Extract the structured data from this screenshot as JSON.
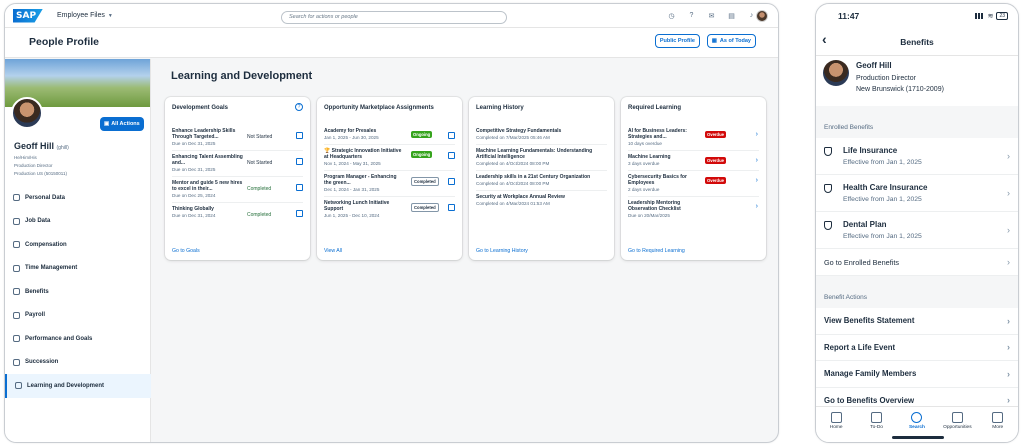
{
  "desktop": {
    "shell": {
      "logo": "SAP",
      "app_menu": "Employee Files",
      "search_placeholder": "Search for actions or people",
      "icons": [
        "clock-icon",
        "help-icon",
        "chat-icon",
        "notes-icon",
        "bell-icon"
      ]
    },
    "header": {
      "title": "People Profile",
      "public_profile": "Public Profile",
      "as_of_today": "As of Today"
    },
    "employee": {
      "name": "Geoff Hill",
      "uid": "(ghill)",
      "pronouns": "He/Him/His",
      "role": "Production Director",
      "location": "Production US (50150011)",
      "all_actions": "All Actions"
    },
    "nav": [
      {
        "label": "Personal Data",
        "icon": "person-icon"
      },
      {
        "label": "Job Data",
        "icon": "briefcase-icon"
      },
      {
        "label": "Compensation",
        "icon": "money-icon"
      },
      {
        "label": "Time Management",
        "icon": "clock-icon"
      },
      {
        "label": "Benefits",
        "icon": "shield-icon"
      },
      {
        "label": "Payroll",
        "icon": "payroll-icon"
      },
      {
        "label": "Performance and Goals",
        "icon": "target-icon"
      },
      {
        "label": "Succession",
        "icon": "org-icon"
      },
      {
        "label": "Learning and Development",
        "icon": "learning-icon",
        "active": true
      }
    ],
    "section_title": "Learning and Development",
    "cards": {
      "goals": {
        "title": "Development Goals",
        "items": [
          {
            "title": "Enhance Leadership Skills Through Targeted...",
            "due": "Due on Dec 31, 2025",
            "status": "Not Started"
          },
          {
            "title": "Enhancing Talent Assembling and...",
            "due": "Due on Dec 31, 2025",
            "status": "Not Started"
          },
          {
            "title": "Mentor and guide 5 new hires to excel in their...",
            "due": "Due on Dec 25, 2024",
            "status": "Completed"
          },
          {
            "title": "Thinking Globally",
            "due": "Due on Dec 31, 2024",
            "status": "Completed"
          }
        ],
        "link": "Go to Goals"
      },
      "marketplace": {
        "title": "Opportunity Marketplace Assignments",
        "items": [
          {
            "title": "Academy for Presales",
            "dates": "Jan 1, 2025 - Jun 30, 2025",
            "status": "Ongoing"
          },
          {
            "title": "🏆 Strategic Innovation Initiative at Headquarters",
            "dates": "Nov 1, 2024 - May 31, 2025",
            "status": "Ongoing"
          },
          {
            "title": "Program Manager - Enhancing the green...",
            "dates": "Dec 1, 2024 - Jan 31, 2025",
            "status": "Completed"
          },
          {
            "title": "Networking Lunch Initiative Support",
            "dates": "Jun 1, 2025 - Dec 10, 2024",
            "status": "Completed"
          }
        ],
        "link": "View All"
      },
      "history": {
        "title": "Learning History",
        "items": [
          {
            "title": "Competitive Strategy Fundamentals",
            "date": "Completed on 7/Mar/2025 05:46 AM"
          },
          {
            "title": "Machine Learning Fundamentals: Understanding Artificial Intelligence",
            "date": "Completed on 4/Oct/2024 08:00 PM"
          },
          {
            "title": "Leadership skills in a 21st Century Organization",
            "date": "Completed on 4/Oct/2024 08:00 PM"
          },
          {
            "title": "Security at Workplace Annual Review",
            "date": "Completed on 4/Mar/2024 01:53 AM"
          }
        ],
        "link": "Go to Learning History"
      },
      "required": {
        "title": "Required Learning",
        "items": [
          {
            "title": "AI for Business Leaders: Strategies and...",
            "due": "10 days overdue",
            "status": "Overdue"
          },
          {
            "title": "Machine Learning",
            "due": "3 days overdue",
            "status": "Overdue"
          },
          {
            "title": "Cybersecurity Basics for Employees",
            "due": "2 days overdue",
            "status": "Overdue"
          },
          {
            "title": "Leadership Mentoring Observation Checklist",
            "due": "Due on 20/Mar/2025",
            "status": ""
          }
        ],
        "link": "Go to Required Learning"
      }
    }
  },
  "mobile": {
    "time": "11:47",
    "battery": "23",
    "title": "Benefits",
    "profile": {
      "name": "Geoff Hill",
      "role": "Production Director",
      "location": "New Brunswick (1710-2009)"
    },
    "enrolled_header": "Enrolled Benefits",
    "benefits": [
      {
        "name": "Life Insurance",
        "effective": "Effective from Jan 1, 2025"
      },
      {
        "name": "Health Care Insurance",
        "effective": "Effective from Jan 1, 2025"
      },
      {
        "name": "Dental Plan",
        "effective": "Effective from Jan 1, 2025"
      }
    ],
    "enrolled_link": "Go to Enrolled Benefits",
    "actions_header": "Benefit Actions",
    "actions": [
      "View Benefits Statement",
      "Report a Life Event",
      "Manage Family Members",
      "Go to Benefits Overview"
    ],
    "tabs": [
      {
        "label": "Home",
        "icon": "home-icon"
      },
      {
        "label": "To-Do",
        "icon": "clipboard-icon"
      },
      {
        "label": "Search",
        "icon": "search-icon",
        "active": true
      },
      {
        "label": "Opportunities",
        "icon": "sparkle-icon"
      },
      {
        "label": "More",
        "icon": "menu-icon"
      }
    ],
    "colors": {
      "accent": "#0a6ed1",
      "overdue": "#d20a0a",
      "ongoing": "#36a41d"
    }
  }
}
